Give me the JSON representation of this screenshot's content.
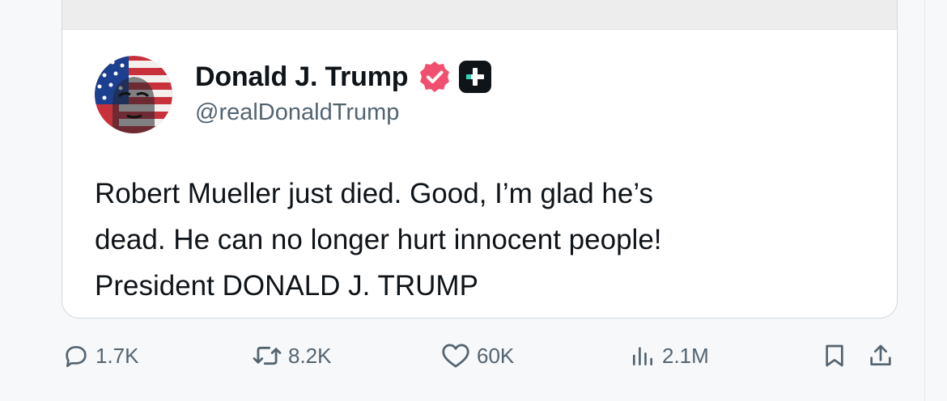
{
  "post": {
    "author": {
      "display_name": "Donald J. Trump",
      "handle": "@realDonaldTrump",
      "verified_icon": "verified-badge-icon",
      "extra_badge_icon": "plus-badge-icon"
    },
    "text_lines": [
      "Robert Mueller just died. Good, I’m glad he’s",
      "dead. He can no longer hurt innocent people!",
      "President DONALD J. TRUMP"
    ]
  },
  "actions": {
    "replies": "1.7K",
    "reposts": "8.2K",
    "likes": "60K",
    "views": "2.1M"
  },
  "colors": {
    "text": "#0f1419",
    "secondary": "#536471",
    "verified_badge": "#f0506e",
    "card_border": "#cfd9de"
  }
}
